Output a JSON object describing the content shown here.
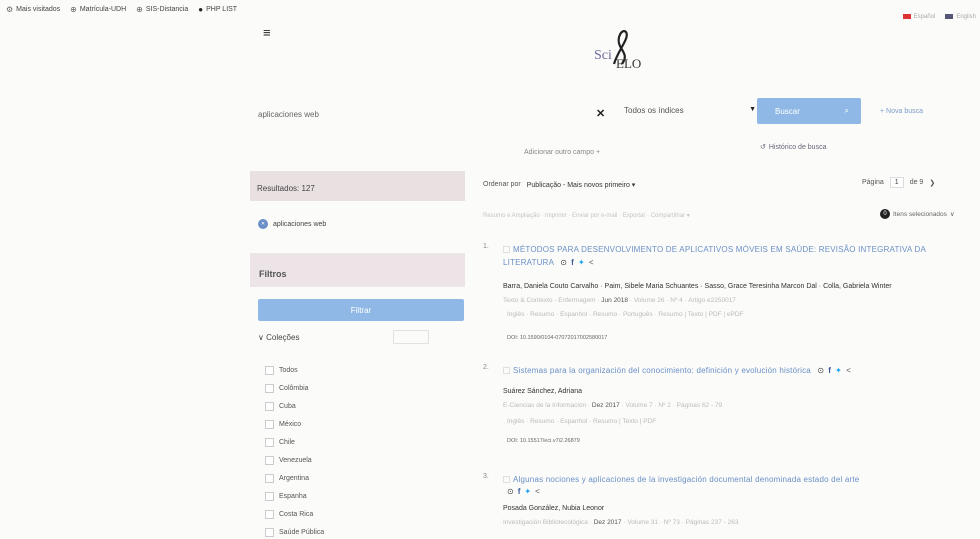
{
  "bookmarks": [
    {
      "icon": "gear-icon",
      "label": "Mais visitados"
    },
    {
      "icon": "globe-icon",
      "label": "Matrícula-UDH"
    },
    {
      "icon": "globe-icon",
      "label": "SIS-Distancia"
    },
    {
      "icon": "php-icon",
      "label": "PHP LIST"
    }
  ],
  "languages": [
    "Español",
    "English"
  ],
  "logo": {
    "sci": "Sci",
    "elo": "ELO"
  },
  "search": {
    "query": "aplicaciones web",
    "index_label": "Todos os índices",
    "button_label": "Buscar",
    "new_search": "+ Nova busca",
    "add_field": "Adicionar outro campo +",
    "history": "Histórico de busca"
  },
  "sidebar": {
    "results_label": "Resultados: 127",
    "chip": "aplicaciones web",
    "filters_title": "Filtros",
    "filter_button": "Filtrar",
    "collections_title": "Coleções",
    "collections_button": "",
    "collections": [
      {
        "name": "Todos",
        "count": ""
      },
      {
        "name": "Colômbia",
        "count": ""
      },
      {
        "name": "Cuba",
        "count": ""
      },
      {
        "name": "México",
        "count": ""
      },
      {
        "name": "Chile",
        "count": ""
      },
      {
        "name": "Venezuela",
        "count": ""
      },
      {
        "name": "Argentina",
        "count": ""
      },
      {
        "name": "Espanha",
        "count": ""
      },
      {
        "name": "Costa Rica",
        "count": ""
      },
      {
        "name": "Saúde Pública",
        "count": ""
      }
    ]
  },
  "results_header": {
    "order_label": "Ordenar por",
    "order_value": "Publicação - Mais novos primeiro ▾",
    "page_label": "Página",
    "page_current": "1",
    "page_total": "de 9",
    "toolbar": "Resumo e Ampliação · Imprimir · Enviar por e-mail · Exportar · Compartilhar ▾",
    "selected_count": "0",
    "selected_label": "Itens selecionados"
  },
  "results": [
    {
      "num": "1.",
      "title": "MÉTODOS PARA DESENVOLVIMENTO DE APLICATIVOS MÓVEIS EM SAÚDE: REVISÃO INTEGRATIVA DA LITERATURA",
      "authors": "Barra, Daniela Couto Carvalho · Paim, Sibele Maria Schuantes · Sasso, Grace Teresinha Marcon Dal · Colla, Gabriela Winter",
      "source_pre": "Texto & Contexto - Enfermagem ·",
      "source_hi": "Jun 2018",
      "source_post": "· Volume 26 · Nº 4 · Artigo e2250017",
      "languages": "Inglês · Resumo · Espanhol · Resumo · Português · Resumo | Texto | PDF | ePDF",
      "doi": "DOI: 10.1590/0104-07072017002580017"
    },
    {
      "num": "2.",
      "title": "Sistemas para la organización del conocimiento: definición y evolución histórica",
      "authors": "Suárez Sánchez, Adriana",
      "source_pre": "E-Ciencias de la Información ·",
      "source_hi": "Dez 2017",
      "source_post": "· Volume 7 · Nº 2 · Páginas 62 - 79",
      "languages": "Inglês · Resumo · Espanhol · Resumo | Texto | PDF",
      "doi": "DOI: 10.15517/eci.v7i2.26879"
    },
    {
      "num": "3.",
      "title": "Algunas nociones y aplicaciones de la investigación documental denominada estado del arte",
      "authors": "Posada González, Nubia Leonor",
      "source_pre": "Investigación Bibliotecológica ·",
      "source_hi": "Dez 2017",
      "source_post": "· Volume 31 · Nº 73 · Páginas 237 - 263",
      "languages": "",
      "doi": ""
    }
  ]
}
